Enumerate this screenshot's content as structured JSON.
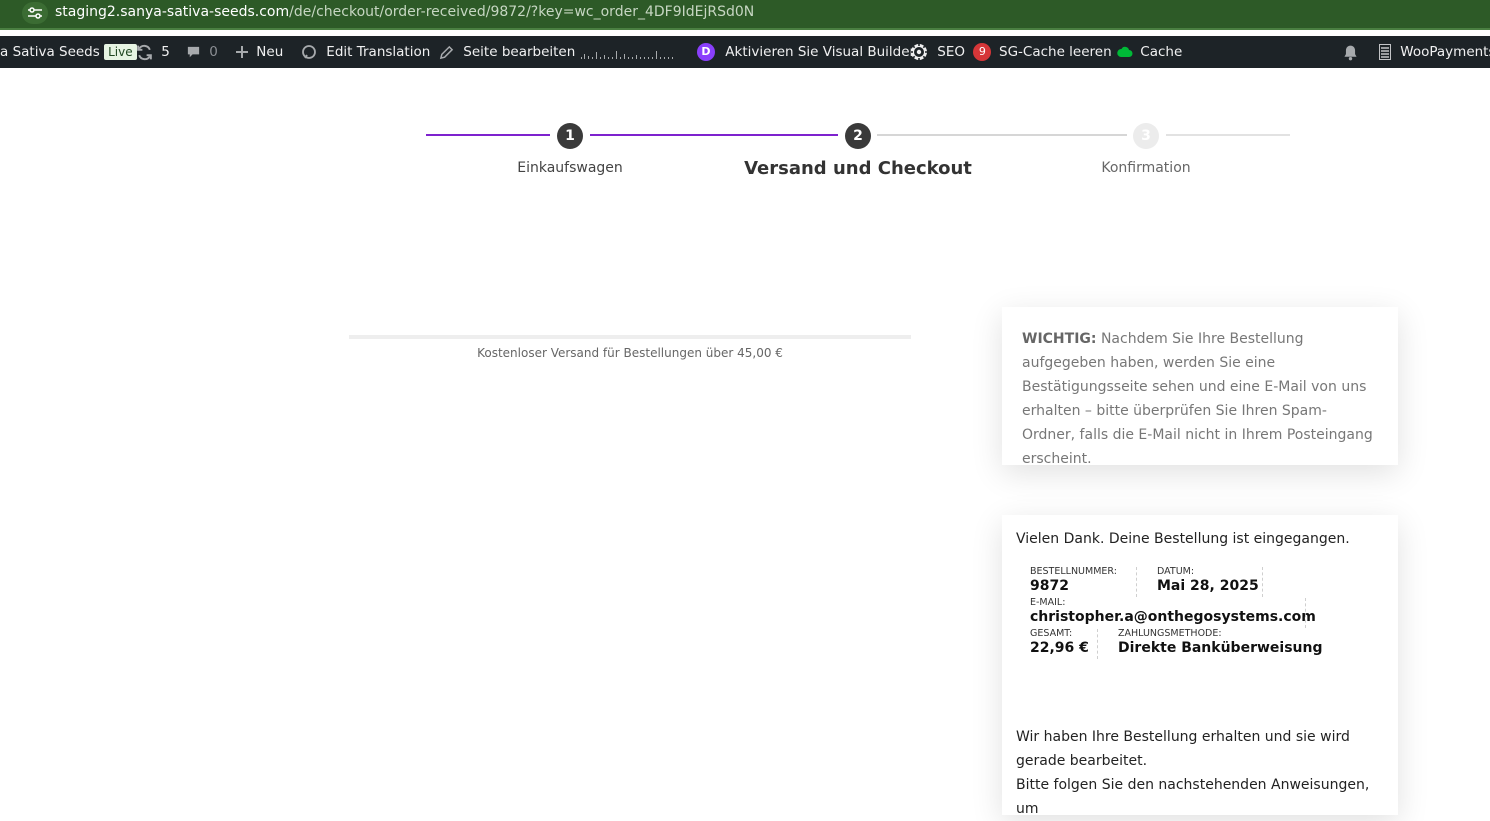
{
  "browser": {
    "url_host": "staging2.sanya-sativa-seeds.com",
    "url_path": "/de/checkout/order-received/9872/?key=wc_order_4DF9IdEjRSd0N"
  },
  "admin_bar": {
    "site_name": "a Sativa Seeds",
    "live_badge": "Live",
    "updates_count": "5",
    "comments_count": "0",
    "new_label": "Neu",
    "edit_translation": "Edit Translation",
    "edit_page": "Seite bearbeiten",
    "visual_builder": "Aktivieren Sie Visual Builder",
    "visual_builder_icon_letter": "D",
    "seo_label": "SEO",
    "seo_badge": "9",
    "sg_cache": "SG-Cache leeren",
    "cache": "Cache",
    "woopayments": "WooPayments –"
  },
  "steps": [
    {
      "number": "1",
      "label": "Einkaufswagen",
      "state": "done"
    },
    {
      "number": "2",
      "label": "Versand und Checkout",
      "state": "current"
    },
    {
      "number": "3",
      "label": "Konfirmation",
      "state": "upcoming"
    }
  ],
  "colors": {
    "progress_active": "#7e22ce",
    "progress_inactive": "#d6d6d6",
    "step_dot_active": "#3a3a3a",
    "step_dot_inactive": "#ececec"
  },
  "shipping": {
    "free_shipping_note": "Kostenloser Versand für Bestellungen über 45,00 €"
  },
  "notice": {
    "lead": "WICHTIG:",
    "text": " Nachdem Sie Ihre Bestellung aufgegeben haben, werden Sie eine Bestätigungsseite sehen und eine E-Mail von uns erhalten – bitte überprüfen Sie Ihren Spam-Ordner, falls die E-Mail nicht in Ihrem Posteingang erscheint."
  },
  "order": {
    "thank_you": "Vielen Dank. Deine Bestellung ist eingegangen.",
    "number_label": "BESTELLNUMMER:",
    "number": "9872",
    "date_label": "DATUM:",
    "date": "Mai 28, 2025",
    "email_label": "E-MAIL:",
    "email": "christopher.a@onthegosystems.com",
    "total_label": "GESAMT:",
    "total": "22,96 €",
    "payment_label": "ZAHLUNGSMETHODE:",
    "payment": "Direkte Banküberweisung",
    "received_line1": "Wir haben Ihre Bestellung erhalten und sie wird gerade bearbeitet.",
    "received_line2": "Bitte folgen Sie den nachstehenden Anweisungen, um"
  }
}
